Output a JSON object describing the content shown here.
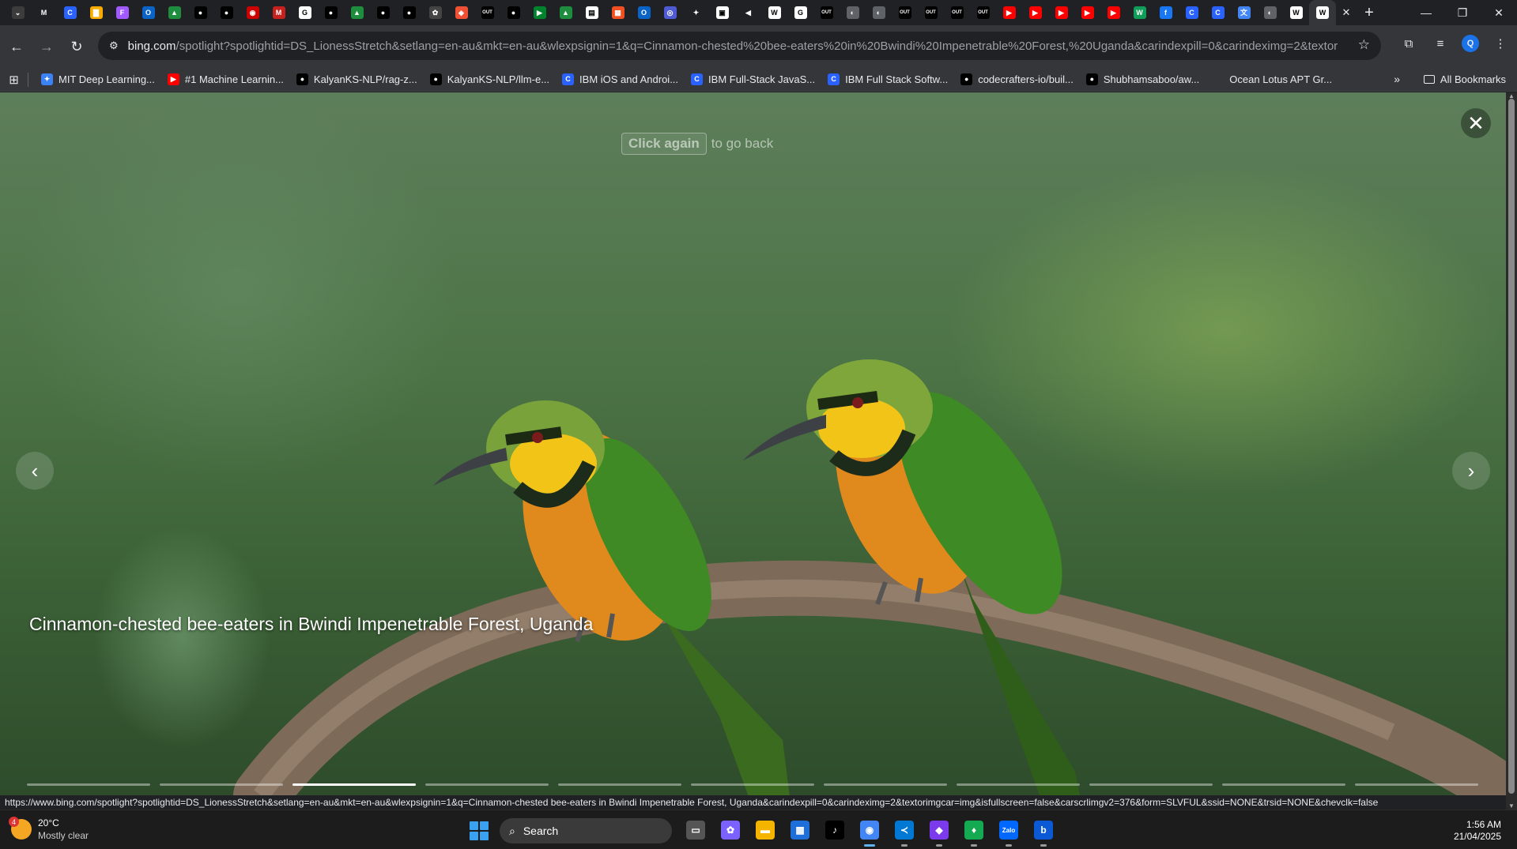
{
  "browser": {
    "tabs": [
      {
        "icon": "menu-tabs-icon",
        "color": "#3c3c3c",
        "glyph": "⌄"
      },
      {
        "icon": "m-icon",
        "color": "#202124",
        "glyph": "M"
      },
      {
        "icon": "c-icon",
        "color": "#2962ff",
        "glyph": "C"
      },
      {
        "icon": "notes-icon",
        "color": "#f9ab00",
        "glyph": "▇"
      },
      {
        "icon": "figma-icon",
        "color": "#a259ff",
        "glyph": "F"
      },
      {
        "icon": "outlook-icon",
        "color": "#0a64c8",
        "glyph": "O"
      },
      {
        "icon": "drive-icon",
        "color": "#1e8e3e",
        "glyph": "▲"
      },
      {
        "icon": "github-icon",
        "color": "#000000",
        "glyph": "●"
      },
      {
        "icon": "github-icon",
        "color": "#000000",
        "glyph": "●"
      },
      {
        "icon": "redhat-icon",
        "color": "#cc0000",
        "glyph": "◉"
      },
      {
        "icon": "gmail-icon",
        "color": "#c5221f",
        "glyph": "M"
      },
      {
        "icon": "google-icon",
        "color": "#ffffff",
        "glyph": "G"
      },
      {
        "icon": "github-icon",
        "color": "#000000",
        "glyph": "●"
      },
      {
        "icon": "drive-icon",
        "color": "#1e8e3e",
        "glyph": "▲"
      },
      {
        "icon": "github-icon",
        "color": "#000000",
        "glyph": "●"
      },
      {
        "icon": "github-icon",
        "color": "#000000",
        "glyph": "●"
      },
      {
        "icon": "openai-icon",
        "color": "#444444",
        "glyph": "✿"
      },
      {
        "icon": "git-icon",
        "color": "#f05033",
        "glyph": "◆"
      },
      {
        "icon": "out-icon",
        "color": "#000000",
        "glyph": "OUT"
      },
      {
        "icon": "github-icon",
        "color": "#000000",
        "glyph": "●"
      },
      {
        "icon": "meet-icon",
        "color": "#00832d",
        "glyph": "▶"
      },
      {
        "icon": "drive-icon",
        "color": "#1e8e3e",
        "glyph": "▲"
      },
      {
        "icon": "docs-icon",
        "color": "#ffffff",
        "glyph": "▤"
      },
      {
        "icon": "ms-icon",
        "color": "#f25022",
        "glyph": "▦"
      },
      {
        "icon": "outlook-icon",
        "color": "#0a64c8",
        "glyph": "O"
      },
      {
        "icon": "circle-icon",
        "color": "#4f5bd5",
        "glyph": "◎"
      },
      {
        "icon": "gemini-icon",
        "color": "#202124",
        "glyph": "✦"
      },
      {
        "icon": "image-icon",
        "color": "#ffffff",
        "glyph": "▣"
      },
      {
        "icon": "sound-icon",
        "color": "#202124",
        "glyph": "◀"
      },
      {
        "icon": "wiki-icon",
        "color": "#ffffff",
        "glyph": "W"
      },
      {
        "icon": "google-icon",
        "color": "#ffffff",
        "glyph": "G"
      },
      {
        "icon": "out-icon",
        "color": "#000000",
        "glyph": "OUT"
      },
      {
        "icon": "globe-icon",
        "color": "#5f6368",
        "glyph": "◐"
      },
      {
        "icon": "globe-icon",
        "color": "#5f6368",
        "glyph": "◐"
      },
      {
        "icon": "out-icon",
        "color": "#000000",
        "glyph": "OUT"
      },
      {
        "icon": "out-icon",
        "color": "#000000",
        "glyph": "OUT"
      },
      {
        "icon": "out-icon",
        "color": "#000000",
        "glyph": "OUT"
      },
      {
        "icon": "out-icon",
        "color": "#000000",
        "glyph": "OUT"
      },
      {
        "icon": "youtube-icon",
        "color": "#ff0000",
        "glyph": "▶"
      },
      {
        "icon": "youtube-icon",
        "color": "#ff0000",
        "glyph": "▶"
      },
      {
        "icon": "youtube-icon",
        "color": "#ff0000",
        "glyph": "▶"
      },
      {
        "icon": "youtube-icon",
        "color": "#ff0000",
        "glyph": "▶"
      },
      {
        "icon": "youtube-icon",
        "color": "#ff0000",
        "glyph": "▶"
      },
      {
        "icon": "w-icon",
        "color": "#0f9d58",
        "glyph": "W"
      },
      {
        "icon": "facebook-icon",
        "color": "#1877f2",
        "glyph": "f"
      },
      {
        "icon": "c-icon",
        "color": "#2962ff",
        "glyph": "C"
      },
      {
        "icon": "c-icon",
        "color": "#2962ff",
        "glyph": "C"
      },
      {
        "icon": "translate-icon",
        "color": "#4285f4",
        "glyph": "文"
      },
      {
        "icon": "globe-icon",
        "color": "#5f6368",
        "glyph": "◐"
      },
      {
        "icon": "wiki-icon",
        "color": "#ffffff",
        "glyph": "W"
      }
    ],
    "active_tab_close": "✕",
    "new_tab": "+",
    "window_controls": {
      "minimize": "—",
      "restore": "❐",
      "close": "✕"
    },
    "url_host": "bing.com",
    "url_rest": "/spotlight?spotlightid=DS_LionessStretch&setlang=en-au&mkt=en-au&wlexpsignin=1&q=Cinnamon-chested%20bee-eaters%20in%20Bwindi%20Impenetrable%20Forest,%20Uganda&carindexpill=0&carindeximg=2&textorimgcar=img&i...",
    "profile_initial": "Q"
  },
  "bookmarks": [
    {
      "label": "MIT Deep Learning...",
      "icon": "mit-icon",
      "color": "#3b82f6",
      "glyph": "✦"
    },
    {
      "label": "#1 Machine Learnin...",
      "icon": "youtube-icon",
      "color": "#ff0000",
      "glyph": "▶"
    },
    {
      "label": "KalyanKS-NLP/rag-z...",
      "icon": "github-icon",
      "color": "#000000",
      "glyph": "●"
    },
    {
      "label": "KalyanKS-NLP/llm-e...",
      "icon": "github-icon",
      "color": "#000000",
      "glyph": "●"
    },
    {
      "label": "IBM iOS and Androi...",
      "icon": "coursera-icon",
      "color": "#2962ff",
      "glyph": "C"
    },
    {
      "label": "IBM Full-Stack JavaS...",
      "icon": "coursera-icon",
      "color": "#2962ff",
      "glyph": "C"
    },
    {
      "label": "IBM Full Stack Softw...",
      "icon": "coursera-icon",
      "color": "#2962ff",
      "glyph": "C"
    },
    {
      "label": "codecrafters-io/buil...",
      "icon": "github-icon",
      "color": "#000000",
      "glyph": "●"
    },
    {
      "label": "Shubhamsaboo/aw...",
      "icon": "github-icon",
      "color": "#000000",
      "glyph": "●"
    },
    {
      "label": "Ocean Lotus APT Gr...",
      "icon": "blank-icon",
      "color": "#35363a",
      "glyph": ""
    }
  ],
  "bookmarks_more": "»",
  "all_bookmarks": "All Bookmarks",
  "spotlight": {
    "hint_key": "Click again",
    "hint_text": "to go back",
    "caption": "Cinnamon-chested bee-eaters in Bwindi Impenetrable Forest, Uganda",
    "slide_count": 11,
    "active_slide": 3,
    "close": "✕",
    "prev": "‹",
    "next": "›"
  },
  "status_url": "https://www.bing.com/spotlight?spotlightid=DS_LionessStretch&setlang=en-au&mkt=en-au&wlexpsignin=1&q=Cinnamon-chested bee-eaters in Bwindi Impenetrable Forest, Uganda&carindexpill=0&carindeximg=2&textorimgcar=img&isfullscreen=false&carscrlimgv2=376&form=SLVFUL&ssid=NONE&trsid=NONE&chevclk=false",
  "taskbar": {
    "weather_badge": "4",
    "temperature": "20°C",
    "condition": "Mostly clear",
    "search_label": "Search",
    "apps": [
      {
        "name": "task-view-icon",
        "color": "#555555",
        "glyph": "▭",
        "running": false
      },
      {
        "name": "copilot-icon",
        "color": "#7b61ff",
        "glyph": "✿",
        "running": false
      },
      {
        "name": "file-explorer-icon",
        "color": "#f5b400",
        "glyph": "▬",
        "running": false
      },
      {
        "name": "store-icon",
        "color": "#1e6fd9",
        "glyph": "▦",
        "running": false
      },
      {
        "name": "tiktok-icon",
        "color": "#000000",
        "glyph": "♪",
        "running": false
      },
      {
        "name": "chrome-icon",
        "color": "#4285f4",
        "glyph": "◉",
        "running": true,
        "focused": true
      },
      {
        "name": "vscode-icon",
        "color": "#0078d4",
        "glyph": "≺",
        "running": true
      },
      {
        "name": "obsidian-icon",
        "color": "#7c3aed",
        "glyph": "◆",
        "running": true
      },
      {
        "name": "mongodb-icon",
        "color": "#13aa52",
        "glyph": "♦",
        "running": true
      },
      {
        "name": "zalo-icon",
        "color": "#0068ff",
        "glyph": "Zalo",
        "running": true
      },
      {
        "name": "bing-icon",
        "color": "#0c59d6",
        "glyph": "b",
        "running": true
      }
    ],
    "time": "1:56 AM",
    "date": "21/04/2025"
  }
}
